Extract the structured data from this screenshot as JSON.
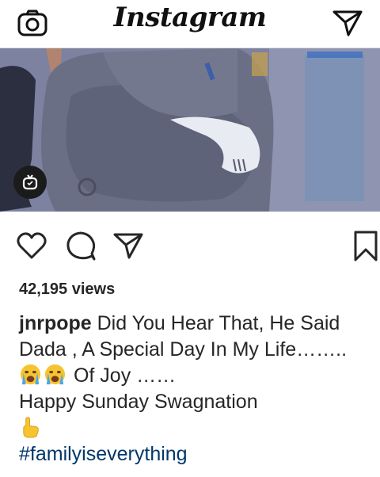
{
  "app": {
    "title": "Instagram"
  },
  "header": {
    "camera_icon": "camera-icon",
    "direct_icon": "paper-plane-icon"
  },
  "post": {
    "media_badge_icon": "igtv-icon",
    "actions": {
      "like_icon": "heart-icon",
      "comment_icon": "speech-bubble-icon",
      "share_icon": "paper-plane-icon",
      "save_icon": "bookmark-icon"
    },
    "views": "42,195 views",
    "caption": {
      "username": "jnrpope",
      "line1": "Did You Hear That, He Said",
      "line2": "Dada , A Special Day In My Life……..",
      "line3": "Of Joy ……",
      "line4": "Happy Sunday Swagnation",
      "hashtag": "#familyiseverything"
    }
  },
  "colors": {
    "text": "#262626",
    "hashtag": "#00376b",
    "divider": "#dbdbdb"
  }
}
